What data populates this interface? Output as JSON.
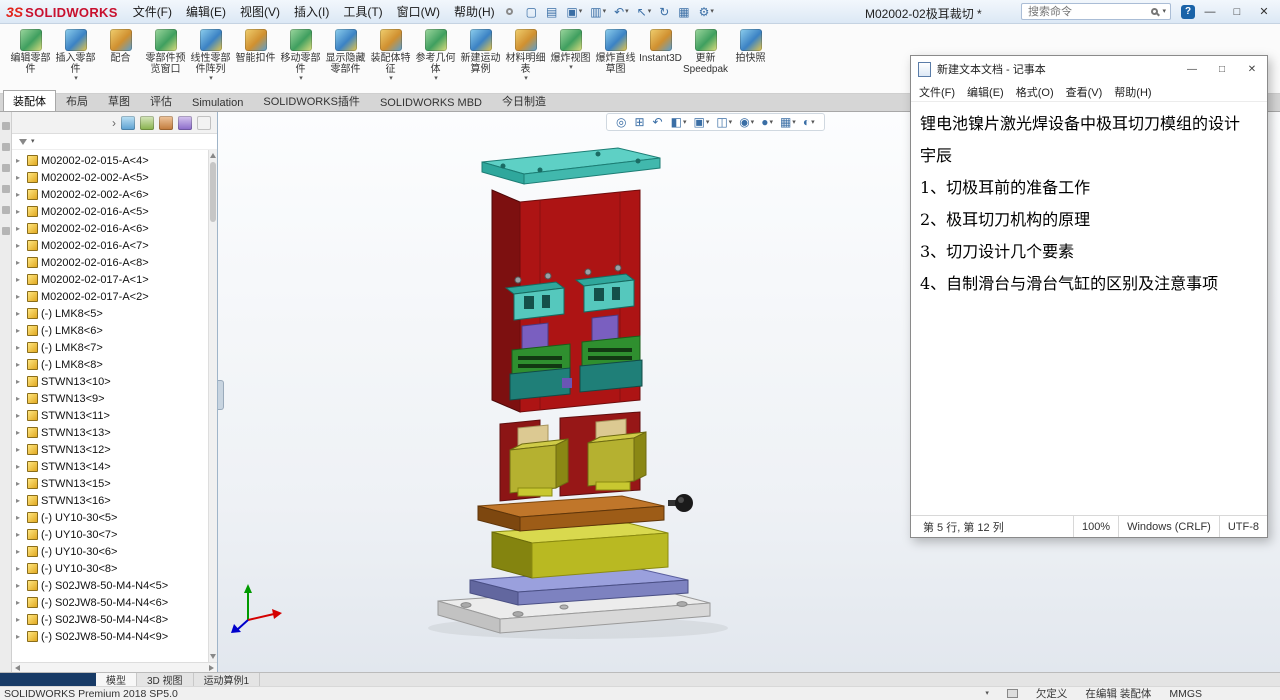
{
  "glyphs": {
    "caret": "▾",
    "expander": "▸",
    "chevron_right": "›"
  },
  "titlebar": {
    "brand_mark": "3S",
    "brand": "SOLIDWORKS",
    "menus": [
      "文件(F)",
      "编辑(E)",
      "视图(V)",
      "插入(I)",
      "工具(T)",
      "窗口(W)",
      "帮助(H)"
    ],
    "quick_access": [
      {
        "name": "new-document-button",
        "glyph": "▢"
      },
      {
        "name": "open-button",
        "glyph": "▤"
      },
      {
        "name": "save-button",
        "glyph": "▣",
        "caret": "▾"
      },
      {
        "name": "print-button",
        "glyph": "▥",
        "caret": "▾"
      },
      {
        "name": "undo-button",
        "glyph": "↶",
        "caret": "▾"
      },
      {
        "name": "select-button",
        "glyph": "↖",
        "caret": "▾"
      },
      {
        "name": "rebuild-button",
        "glyph": "↻"
      },
      {
        "name": "file-properties-button",
        "glyph": "▦"
      },
      {
        "name": "options-button",
        "glyph": "⚙",
        "caret": "▾"
      }
    ],
    "doc_title": "M02002-02极耳裁切 *",
    "search_placeholder": "搜索命令",
    "window_controls": {
      "help": "?",
      "minimize": "—",
      "maximize": "□",
      "close": "✕"
    }
  },
  "ribbon": {
    "buttons": [
      {
        "label": "编辑零部件"
      },
      {
        "label": "插入零部件",
        "caret": "▾"
      },
      {
        "label": "配合"
      },
      {
        "label": "零部件预览窗口"
      },
      {
        "label": "线性零部件阵列",
        "caret": "▾"
      },
      {
        "label": "智能扣件"
      },
      {
        "label": "移动零部件",
        "caret": "▾"
      },
      {
        "label": "显示隐藏零部件"
      },
      {
        "label": "装配体特征",
        "caret": "▾"
      },
      {
        "label": "参考几何体",
        "caret": "▾"
      },
      {
        "label": "新建运动算例"
      },
      {
        "label": "材料明细表",
        "caret": "▾"
      },
      {
        "label": "爆炸视图",
        "caret": "▾"
      },
      {
        "label": "爆炸直线草图"
      },
      {
        "label": "Instant3D"
      },
      {
        "label": "更新Speedpak"
      },
      {
        "label": "拍快照"
      }
    ]
  },
  "ribbon_tabs": [
    {
      "label": "装配体",
      "active": true
    },
    {
      "label": "布局"
    },
    {
      "label": "草图"
    },
    {
      "label": "评估"
    },
    {
      "label": "Simulation"
    },
    {
      "label": "SOLIDWORKS插件"
    },
    {
      "label": "SOLIDWORKS MBD"
    },
    {
      "label": "今日制造"
    }
  ],
  "left_toolbar": [
    {
      "name": "side-toolbar-button-1"
    },
    {
      "name": "side-toolbar-button-2"
    },
    {
      "name": "side-toolbar-button-3"
    },
    {
      "name": "side-toolbar-button-4"
    },
    {
      "name": "side-toolbar-button-5"
    },
    {
      "name": "side-toolbar-button-6"
    }
  ],
  "tree": {
    "tabs": [
      {
        "name": "featuremanager-tab"
      },
      {
        "name": "propertymanager-tab"
      },
      {
        "name": "configurationmanager-tab"
      },
      {
        "name": "dimxpertmanager-tab"
      },
      {
        "name": "displaymanager-tab"
      }
    ],
    "items": [
      "M02002-02-015-A<4>",
      "M02002-02-002-A<5>",
      "M02002-02-002-A<6>",
      "M02002-02-016-A<5>",
      "M02002-02-016-A<6>",
      "M02002-02-016-A<7>",
      "M02002-02-016-A<8>",
      "M02002-02-017-A<1>",
      "M02002-02-017-A<2>",
      "(-) LMK8<5>",
      "(-) LMK8<6>",
      "(-) LMK8<7>",
      "(-) LMK8<8>",
      "STWN13<10>",
      "STWN13<9>",
      "STWN13<11>",
      "STWN13<13>",
      "STWN13<12>",
      "STWN13<14>",
      "STWN13<15>",
      "STWN13<16>",
      "(-) UY10-30<5>",
      "(-) UY10-30<7>",
      "(-) UY10-30<6>",
      "(-) UY10-30<8>",
      "(-) S02JW8-50-M4-N4<5>",
      "(-) S02JW8-50-M4-N4<6>",
      "(-) S02JW8-50-M4-N4<8>",
      "(-) S02JW8-50-M4-N4<9>"
    ]
  },
  "headsup": [
    {
      "name": "zoom-to-fit-icon",
      "glyph": "◎"
    },
    {
      "name": "zoom-to-area-icon",
      "glyph": "⊞"
    },
    {
      "name": "previous-view-icon",
      "glyph": "↶"
    },
    {
      "name": "section-view-icon",
      "glyph": "◧",
      "caret": "▾"
    },
    {
      "name": "view-orientation-icon",
      "glyph": "▣",
      "caret": "▾"
    },
    {
      "name": "display-style-icon",
      "glyph": "◫",
      "caret": "▾"
    },
    {
      "name": "hide-show-items-icon",
      "glyph": "◉",
      "caret": "▾"
    },
    {
      "name": "edit-appearance-icon",
      "glyph": "●",
      "caret": "▾"
    },
    {
      "name": "apply-scene-icon",
      "glyph": "▦",
      "caret": "▾"
    },
    {
      "name": "view-settings-icon",
      "glyph": "◐",
      "caret": "▾"
    }
  ],
  "notepad": {
    "title": "新建文本文档 - 记事本",
    "menus": [
      "文件(F)",
      "编辑(E)",
      "格式(O)",
      "查看(V)",
      "帮助(H)"
    ],
    "lines": [
      "锂电池镍片激光焊设备中极耳切刀模组的设计",
      "宇辰",
      "1、切极耳前的准备工作",
      "2、极耳切刀机构的原理",
      "3、切刀设计几个要素",
      "4、自制滑台与滑台气缸的区别及注意事项"
    ],
    "status": {
      "position": "第 5 行, 第 12 列",
      "zoom": "100%",
      "line_ending": "Windows (CRLF)",
      "encoding": "UTF-8"
    },
    "controls": {
      "minimize": "—",
      "maximize": "□",
      "close": "✕"
    }
  },
  "bottom_tabs": [
    {
      "label": "模型",
      "active": true
    },
    {
      "label": "3D 视图"
    },
    {
      "label": "运动算例1"
    }
  ],
  "statusbar": {
    "left": "SOLIDWORKS Premium 2018 SP5.0",
    "items": [
      "欠定义",
      "在编辑 装配体",
      "MMGS"
    ]
  }
}
